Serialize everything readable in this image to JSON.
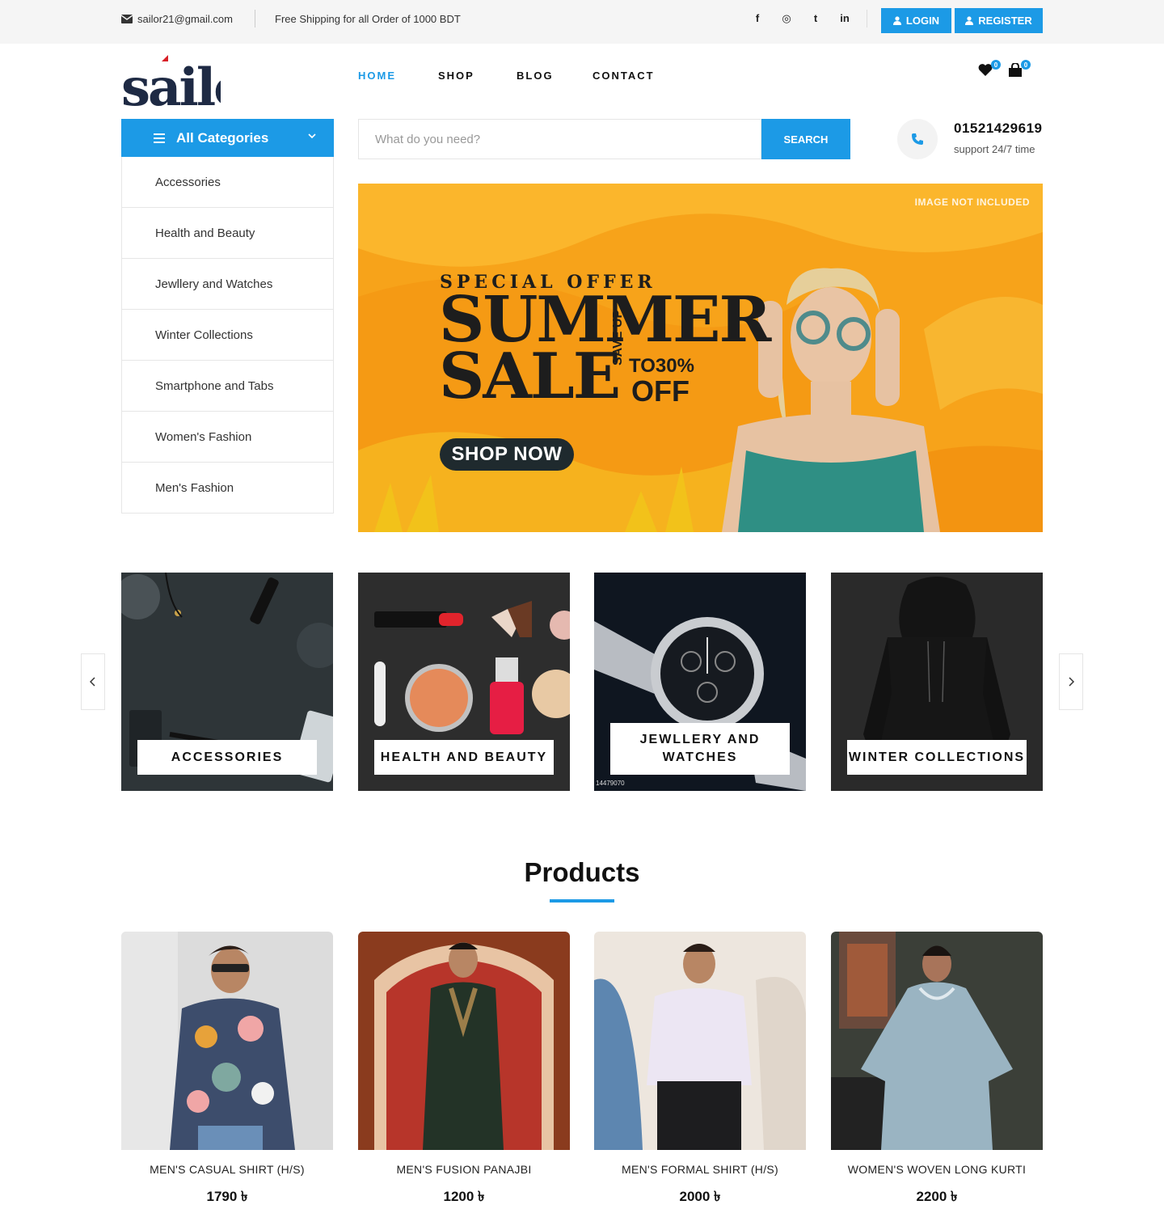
{
  "topbar": {
    "email": "sailor21@gmail.com",
    "shipping": "Free Shipping for all Order of 1000 BDT",
    "social": [
      "f",
      "◎",
      "t",
      "in"
    ],
    "login": "LOGIN",
    "register": "REGISTER"
  },
  "brand": {
    "logo_text": "sailor",
    "accent": "#1c9ae6"
  },
  "nav": [
    {
      "label": "HOME",
      "active": true
    },
    {
      "label": "SHOP"
    },
    {
      "label": "BLOG"
    },
    {
      "label": "CONTACT"
    }
  ],
  "header_icons": {
    "wishlist_count": "0",
    "cart_count": "0"
  },
  "categories": {
    "title": "All Categories",
    "items": [
      "Accessories",
      "Health and Beauty",
      "Jewllery and Watches",
      "Winter Collections",
      "Smartphone and Tabs",
      "Women's Fashion",
      "Men's Fashion"
    ]
  },
  "search": {
    "placeholder": "What do you need?",
    "button": "SEARCH"
  },
  "support": {
    "phone": "01521429619",
    "text": "support 24/7 time"
  },
  "hero": {
    "note": "IMAGE NOT INCLUDED",
    "special": "SPECIAL OFFER",
    "line1": "SUMMER",
    "line2": "SALE",
    "save_up": "SAVE UP",
    "to": "TO30%",
    "off": "OFF",
    "cta": "SHOP NOW"
  },
  "tiles": [
    {
      "label": "ACCESSORIES"
    },
    {
      "label": "HEALTH AND BEAUTY"
    },
    {
      "label": "JEWLLERY AND WATCHES",
      "line1": "JEWLLERY AND",
      "line2": "WATCHES",
      "caption": "14479070"
    },
    {
      "label": "WINTER COLLECTIONS"
    }
  ],
  "products": {
    "title": "Products",
    "items": [
      {
        "name": "MEN'S CASUAL SHIRT (H/S)",
        "price": "1790 ৳"
      },
      {
        "name": "MEN'S FUSION PANAJBI",
        "price": "1200 ৳"
      },
      {
        "name": "MEN'S FORMAL SHIRT (H/S)",
        "price": "2000 ৳"
      },
      {
        "name": "WOMEN'S WOVEN LONG KURTI",
        "price": "2200 ৳"
      }
    ]
  }
}
